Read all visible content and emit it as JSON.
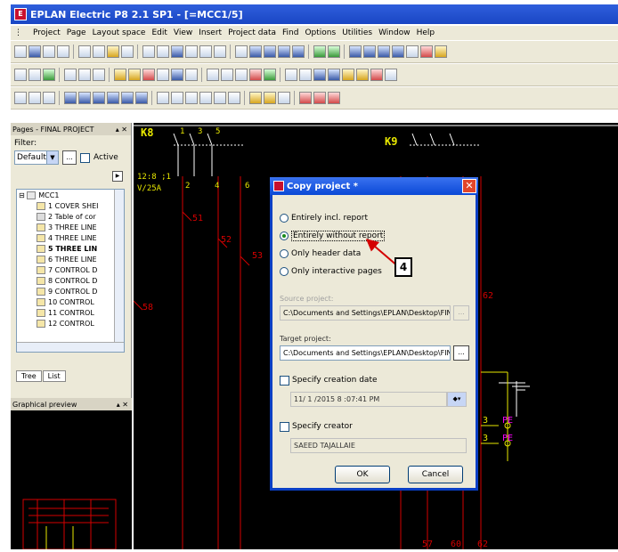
{
  "window": {
    "title": "EPLAN Electric P8 2.1 SP1 - [=MCC1/5]"
  },
  "menu": [
    "Project",
    "Page",
    "Layout space",
    "Edit",
    "View",
    "Insert",
    "Project data",
    "Find",
    "Options",
    "Utilities",
    "Window",
    "Help"
  ],
  "pages_panel": {
    "title": "Pages - FINAL PROJECT",
    "filter_label": "Filter:",
    "filter_value": "Default",
    "dots_label": "...",
    "active_label": "Active",
    "tree_root": "MCC1",
    "tree_items": [
      "1 COVER SHEI",
      "2 Table of cor",
      "3 THREE LINE",
      "4 THREE LINE",
      "5 THREE LIN",
      "6 THREE LINE",
      "7 CONTROL D",
      "8 CONTROL D",
      "9 CONTROL D",
      "10 CONTROL",
      "11 CONTROL",
      "12 CONTROL"
    ],
    "tabs": [
      "Tree",
      "List"
    ]
  },
  "preview_panel": {
    "title": "Graphical preview"
  },
  "canvas": {
    "labels": [
      "K8",
      "K9",
      "12:8 ;1",
      "V/25A",
      "51",
      "52",
      "53",
      "58",
      "62",
      "2",
      "4",
      "6",
      "3",
      "5",
      "1",
      "PE",
      "PE",
      "3",
      "3",
      "57",
      "60",
      "62"
    ]
  },
  "dialog": {
    "title": "Copy project *",
    "options": [
      "Entirely incl. report",
      "Entirely without report",
      "Only header data",
      "Only interactive pages"
    ],
    "selected_option": 1,
    "source_label": "Source project:",
    "source_value": "C:\\Documents and Settings\\EPLAN\\Desktop\\FINAL PRO",
    "target_label": "Target project:",
    "target_value": "C:\\Documents and Settings\\EPLAN\\Desktop\\FINAL PRO",
    "dots_label": "...",
    "date_label": "Specify creation date",
    "date_value": "11/ 1 /2015  8 :07:41 PM",
    "creator_label": "Specify creator",
    "creator_value": "SAEED TAJALLAIE",
    "ok_label": "OK",
    "cancel_label": "Cancel"
  },
  "annotation": {
    "callout_number": "4",
    "color": "#d40000"
  },
  "colors": {
    "canvas": "#000000",
    "wire_red": "#d40000",
    "wire_white": "#ffffff",
    "wire_yellow": "#e8e800",
    "pe_magenta": "#ff00ff"
  }
}
